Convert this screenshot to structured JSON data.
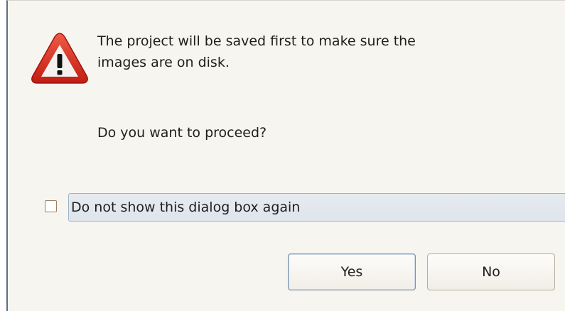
{
  "dialog": {
    "icon": "warning-triangle-icon",
    "message_line1": "The project will be saved first to make sure the",
    "message_line2": "images are on disk.",
    "question": "Do you want to proceed?",
    "checkbox": {
      "label": "Do not show this dialog box again",
      "checked": false
    },
    "buttons": {
      "yes_label": "Yes",
      "no_label": "No"
    }
  },
  "colors": {
    "dialog_background": "#f7f5f0",
    "warning_red": "#d42a1f",
    "label_highlight": "#e2e8ef",
    "default_button_border": "#7b93ad"
  }
}
